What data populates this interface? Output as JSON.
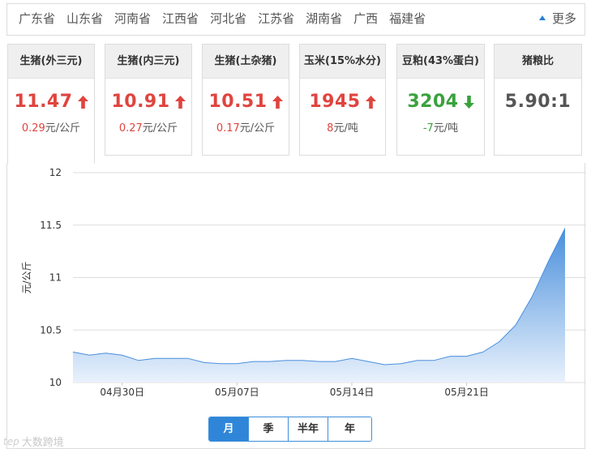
{
  "provinces": [
    "广东省",
    "山东省",
    "河南省",
    "江西省",
    "河北省",
    "江苏省",
    "湖南省",
    "广西",
    "福建省"
  ],
  "more_label": "更多",
  "cards": [
    {
      "title": "生猪(外三元)",
      "price": "11.47",
      "direction": "up",
      "change": "0.29",
      "unit": "元/公斤"
    },
    {
      "title": "生猪(内三元)",
      "price": "10.91",
      "direction": "up",
      "change": "0.27",
      "unit": "元/公斤"
    },
    {
      "title": "生猪(土杂猪)",
      "price": "10.51",
      "direction": "up",
      "change": "0.17",
      "unit": "元/公斤"
    },
    {
      "title": "玉米(15%水分)",
      "price": "1945",
      "direction": "up",
      "change": "8",
      "unit": "元/吨"
    },
    {
      "title": "豆粕(43%蛋白)",
      "price": "3204",
      "direction": "down",
      "change": "-7",
      "unit": "元/吨"
    },
    {
      "title": "猪粮比",
      "price": "5.90:1",
      "direction": "none",
      "change": "",
      "unit": ""
    }
  ],
  "period_tabs": [
    "月",
    "季",
    "半年",
    "年"
  ],
  "active_period": "月",
  "watermark_logo": "tep",
  "watermark_text": "大数跨境",
  "colors": {
    "up": "#e0443e",
    "down": "#3aa23c",
    "accent": "#2f86d8",
    "area_top": "#4a8fdc",
    "area_bottom": "#e9f2fc"
  },
  "chart_data": {
    "type": "area",
    "ylabel": "元/公斤",
    "ylim": [
      10,
      12
    ],
    "yticks": [
      "10",
      "10.5",
      "11",
      "11.5",
      "12"
    ],
    "xtick_labels": [
      "04月30日",
      "05月07日",
      "05月14日",
      "05月21日"
    ],
    "xtick_index": [
      3,
      10,
      17,
      24
    ],
    "x": [
      "04月27日",
      "04月28日",
      "04月29日",
      "04月30日",
      "05月01日",
      "05月02日",
      "05月03日",
      "05月04日",
      "05月05日",
      "05月06日",
      "05月07日",
      "05月08日",
      "05月09日",
      "05月10日",
      "05月11日",
      "05月12日",
      "05月13日",
      "05月14日",
      "05月15日",
      "05月16日",
      "05月17日",
      "05月18日",
      "05月19日",
      "05月20日",
      "05月21日",
      "05月22日",
      "05月23日",
      "05月24日",
      "05月25日",
      "05月26日",
      "05月27日"
    ],
    "series": [
      {
        "values": [
          10.29,
          10.26,
          10.28,
          10.26,
          10.21,
          10.23,
          10.23,
          10.23,
          10.19,
          10.18,
          10.18,
          10.2,
          10.2,
          10.21,
          10.21,
          10.2,
          10.2,
          10.23,
          10.2,
          10.17,
          10.18,
          10.21,
          10.21,
          10.25,
          10.25,
          10.29,
          10.39,
          10.55,
          10.82,
          11.16,
          11.47
        ]
      }
    ]
  }
}
